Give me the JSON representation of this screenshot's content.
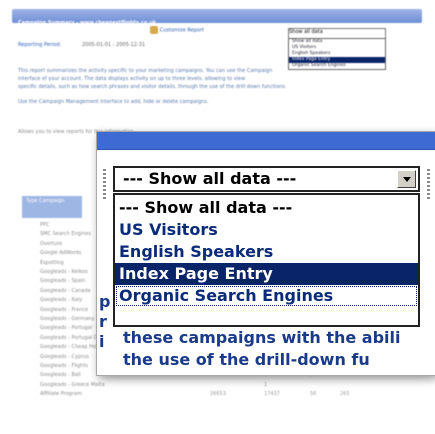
{
  "background": {
    "title": "Campaign Summary - www.cheapestflights.co.uk",
    "toolbar": {
      "report_link": "Customize Report",
      "dropdown_value": "Show all data"
    },
    "mini_options": [
      "Show all data",
      "US Visitors",
      "English Speakers",
      "Index Page Entry",
      "Organic Search Engines"
    ],
    "reporting_period_label": "Reporting Period:",
    "reporting_dates": "2005-01-01 - 2005-12-31",
    "description_lines": [
      "This report summarizes the activity specific to your marketing campaigns. You can use the Campaign",
      "interface of your account. The data displays activity on up to three levels, allowing to view",
      "specific details, such as how search phrases and visitor details, through the use of the drill down functions."
    ],
    "manage_line": "Use the Campaign Management interface to add, hide or delete campaigns.",
    "faint_line": "Allows you to view reports for this information",
    "table_header": "Type Campaign",
    "rows": [
      {
        "name": "PPC",
        "v1": "",
        "v2": "",
        "v3": "",
        "v4": "",
        "v5": ""
      },
      {
        "name": "SMC Search Engines",
        "v1": "",
        "v2": "",
        "v3": "",
        "v4": "",
        "v5": ""
      },
      {
        "name": "Overture",
        "v1": "",
        "v2": "",
        "v3": "",
        "v4": "",
        "v5": ""
      },
      {
        "name": "Google AdWords",
        "v1": "",
        "v2": "",
        "v3": "",
        "v4": "",
        "v5": ""
      },
      {
        "name": "Espotting",
        "v1": "",
        "v2": "",
        "v3": "",
        "v4": "",
        "v5": ""
      },
      {
        "name": "Googleads - Kelkoo",
        "v1": "",
        "v2": "",
        "v3": "",
        "v4": "",
        "v5": ""
      },
      {
        "name": "Googleads - Spain",
        "v1": "",
        "v2": "",
        "v3": "",
        "v4": "",
        "v5": ""
      },
      {
        "name": "Googleads - Canada",
        "v1": "",
        "v2": "",
        "v3": "",
        "v4": "",
        "v5": ""
      },
      {
        "name": "Googleads - Italy",
        "v1": "",
        "v2": "",
        "v3": "",
        "v4": "",
        "v5": ""
      },
      {
        "name": "Googleads - France",
        "v1": "",
        "v2": "",
        "v3": "",
        "v4": "",
        "v5": ""
      },
      {
        "name": "Googleads - Germany",
        "v1": "",
        "v2": "",
        "v3": "",
        "v4": "",
        "v5": ""
      },
      {
        "name": "Googleads - Portugal",
        "v1": "",
        "v2": "",
        "v3": "",
        "v4": "",
        "v5": ""
      },
      {
        "name": "Googleads - Portugal Deals",
        "v1": "34",
        "v2": "1",
        "v3": "0",
        "v4": "0",
        "v5": "0"
      },
      {
        "name": "Googleads - Cheap Hol Deals",
        "v1": "8",
        "v2": "1",
        "v3": "0",
        "v4": "0",
        "v5": "0"
      },
      {
        "name": "Googleads - Cyprus",
        "v1": "8",
        "v2": "1",
        "v3": "0",
        "v4": "0",
        "v5": "0"
      },
      {
        "name": "Googleads - Flights",
        "v1": "",
        "v2": "1",
        "v3": "0",
        "v4": "",
        "v5": ""
      },
      {
        "name": "Googleads - Bali",
        "v1": "",
        "v2": "0",
        "v3": "0",
        "v4": "",
        "v5": ""
      },
      {
        "name": "Googleads - Greece Malta",
        "v1": "",
        "v2": "1",
        "v3": "",
        "v4": "",
        "v5": ""
      },
      {
        "name": "Affiliate Program",
        "v1": "26653",
        "v2": "17437",
        "v3": "56",
        "v4": "265",
        "v5": ""
      }
    ]
  },
  "zoom": {
    "dropdown": {
      "value": "--- Show all data ---"
    },
    "options": [
      {
        "label": "--- Show all data ---"
      },
      {
        "label": "US Visitors"
      },
      {
        "label": "English Speakers"
      },
      {
        "label": "Index Page Entry"
      },
      {
        "label": "Organic Search Engines"
      }
    ],
    "behind_text": [
      "these campaigns with the abili",
      "the use of the drill-down fu"
    ],
    "left_fragments": [
      "p",
      "r",
      "i"
    ]
  }
}
